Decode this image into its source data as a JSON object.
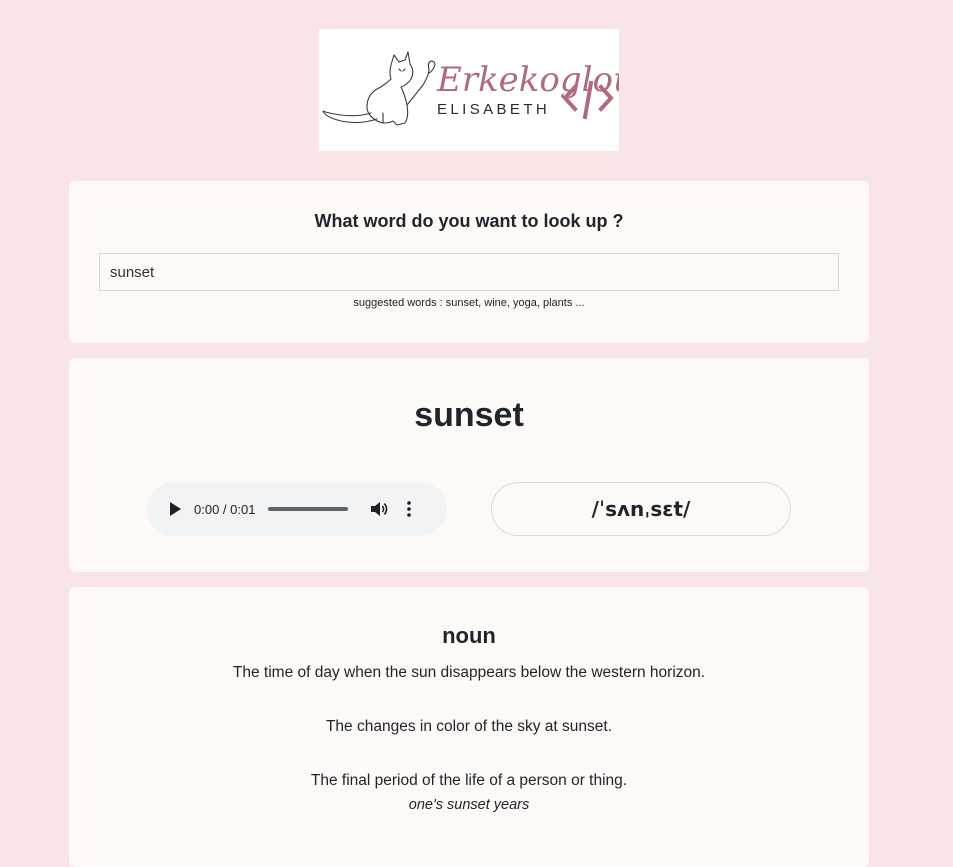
{
  "logo": {
    "script_text": "Erkekoglou",
    "name_text": "ELISABETH",
    "code_mark": "</>",
    "accent_color": "#b06a7e",
    "icon": "cat-icon"
  },
  "search": {
    "heading": "What word do you want to look up ?",
    "value": "sunset",
    "hint": "suggested words : sunset, wine, yoga, plants ..."
  },
  "word": {
    "title": "sunset",
    "phonetic": "/ˈsʌnˌsɛt/",
    "audio": {
      "time": "0:00 / 0:01",
      "progress": 0.0,
      "icons": [
        "play-icon",
        "volume-icon",
        "more-vert-icon"
      ]
    }
  },
  "meaning": {
    "part_of_speech": "noun",
    "definitions": [
      {
        "text": "The time of day when the sun disappears below the western horizon.",
        "example": ""
      },
      {
        "text": "The changes in color of the sky at sunset.",
        "example": ""
      },
      {
        "text": "The final period of the life of a person or thing.",
        "example": "one's sunset years"
      }
    ]
  },
  "colors": {
    "page_background": "#f9e4e6",
    "card_background": "#fdf9f7",
    "text": "#212529"
  }
}
